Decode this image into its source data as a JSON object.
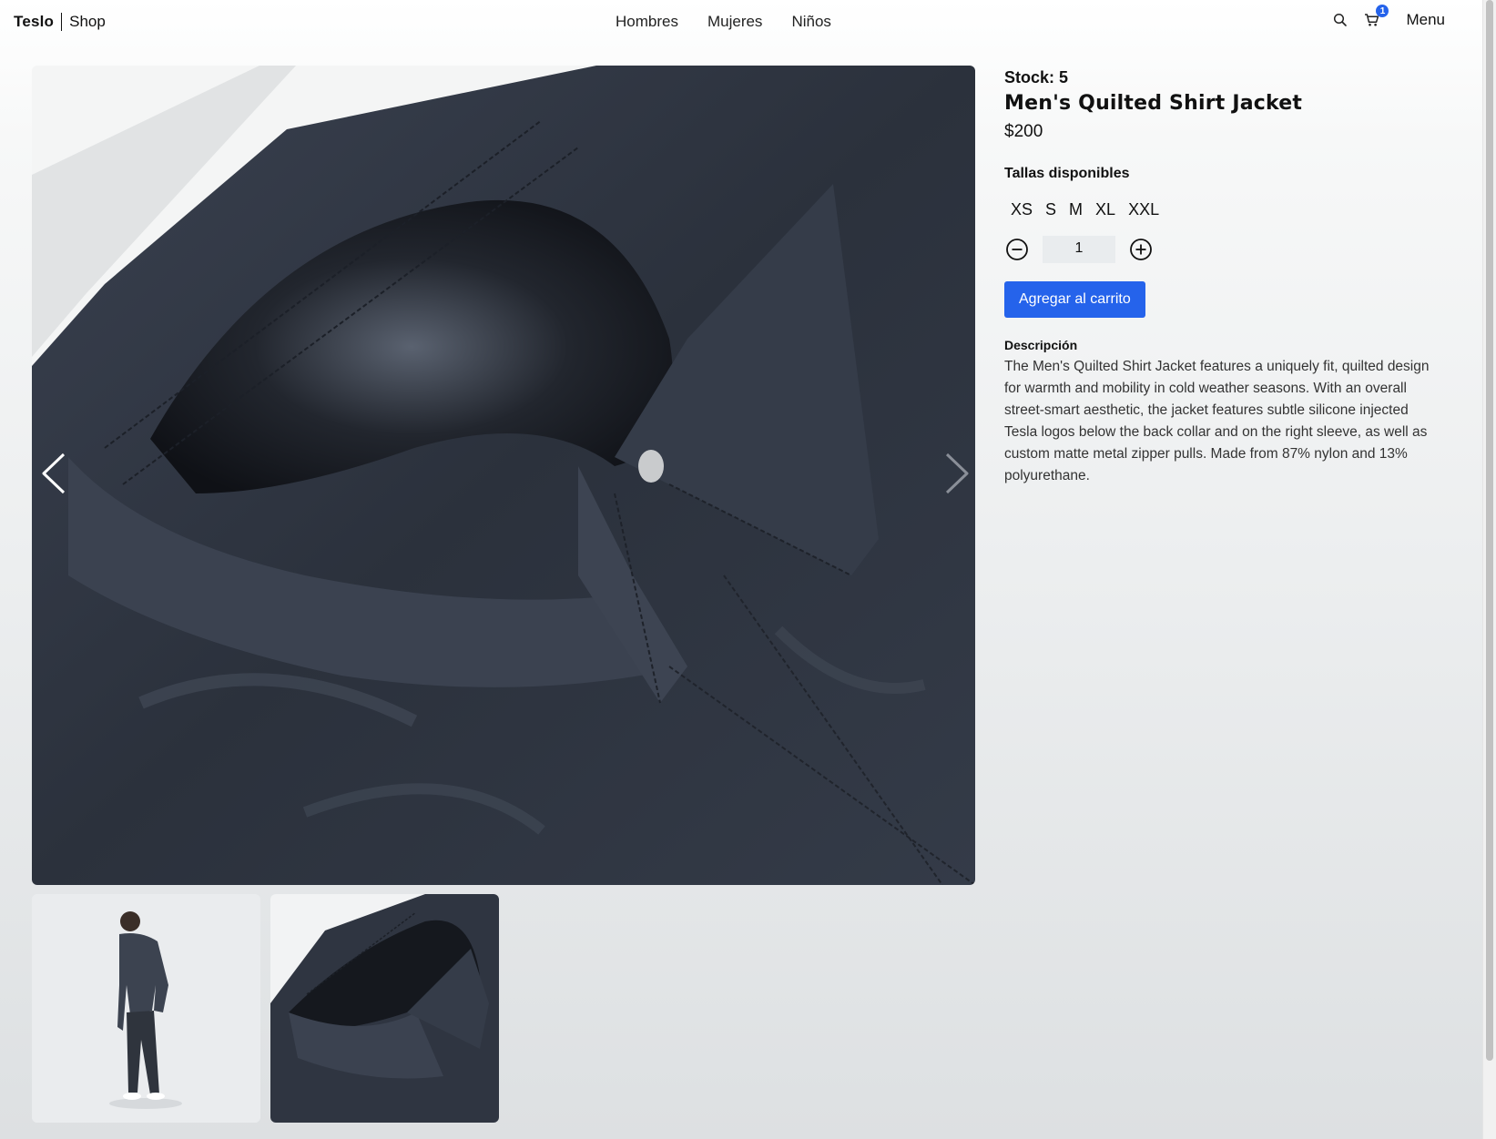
{
  "header": {
    "brand_bold": "Teslo",
    "brand_light": "Shop",
    "nav": [
      "Hombres",
      "Mujeres",
      "Niños"
    ],
    "cart_count": "1",
    "menu_label": "Menu",
    "icons": [
      "search-icon",
      "cart-icon"
    ]
  },
  "gallery": {
    "main_alt": "Men's Quilted Shirt Jacket collar close-up",
    "thumbnails": [
      "model-full-body",
      "collar-close-up"
    ]
  },
  "product": {
    "stock_label": "Stock: 5",
    "title": "Men's Quilted Shirt Jacket",
    "price": "$200",
    "sizes_label": "Tallas disponibles",
    "sizes": [
      "XS",
      "S",
      "M",
      "XL",
      "XXL"
    ],
    "quantity": "1",
    "add_to_cart": "Agregar al carrito",
    "description_label": "Descripción",
    "description": "The Men's Quilted Shirt Jacket features a uniquely fit, quilted design for warmth and mobility in cold weather seasons. With an overall street-smart aesthetic, the jacket features subtle silicone injected Tesla logos below the back collar and on the right sleeve, as well as custom matte metal zipper pulls. Made from 87% nylon and 13% polyurethane."
  },
  "colors": {
    "accent": "#2563eb",
    "jacket": "#2c323e"
  }
}
